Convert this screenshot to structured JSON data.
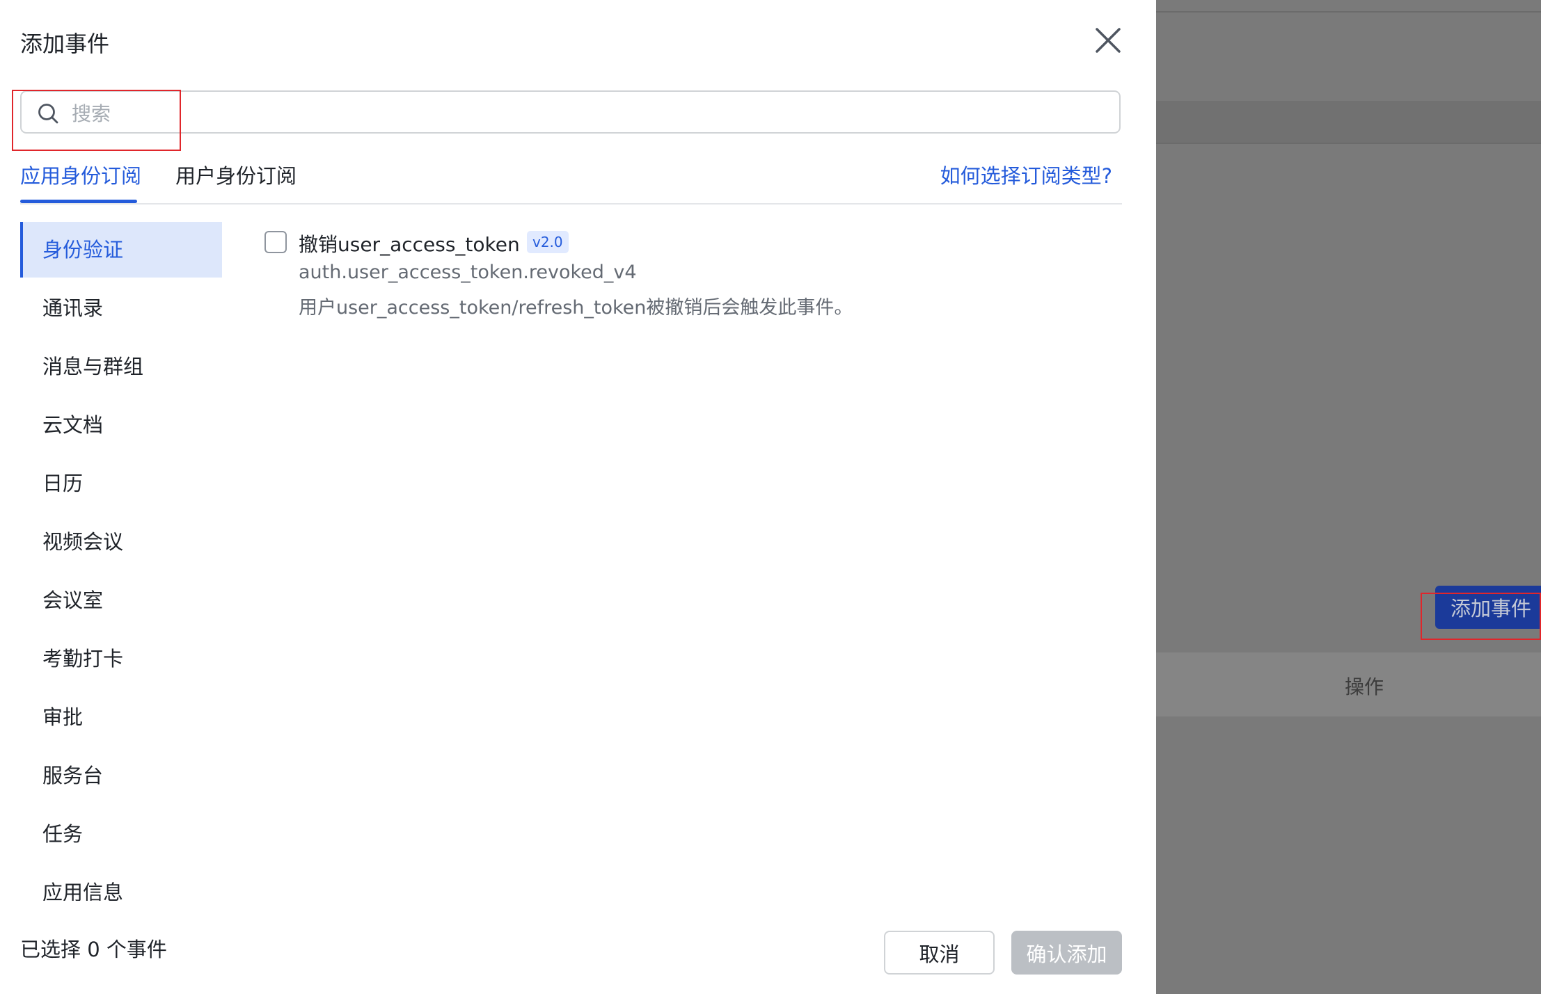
{
  "drawer": {
    "title": "添加事件",
    "search_placeholder": "搜索",
    "tabs": [
      {
        "label": "应用身份订阅",
        "active": true
      },
      {
        "label": "用户身份订阅",
        "active": false
      }
    ],
    "help_link": "如何选择订阅类型?",
    "categories": [
      {
        "label": "身份验证",
        "active": true
      },
      {
        "label": "通讯录"
      },
      {
        "label": "消息与群组"
      },
      {
        "label": "云文档"
      },
      {
        "label": "日历"
      },
      {
        "label": "视频会议"
      },
      {
        "label": "会议室"
      },
      {
        "label": "考勤打卡"
      },
      {
        "label": "审批"
      },
      {
        "label": "服务台"
      },
      {
        "label": "任务"
      },
      {
        "label": "应用信息"
      }
    ],
    "events": [
      {
        "name": "撤销user_access_token",
        "version": "v2.0",
        "key": "auth.user_access_token.revoked_v4",
        "description": "用户user_access_token/refresh_token被撤销后会触发此事件。",
        "checked": false
      }
    ],
    "footer": {
      "selected_text": "已选择 0 个事件",
      "cancel_label": "取消",
      "confirm_label": "确认添加"
    }
  },
  "background": {
    "add_event_button": "添加事件",
    "operation_column": "操作"
  },
  "colors": {
    "accent": "#245bdb",
    "highlight": "#e0262b",
    "disabled_button": "#bbbfc4"
  }
}
